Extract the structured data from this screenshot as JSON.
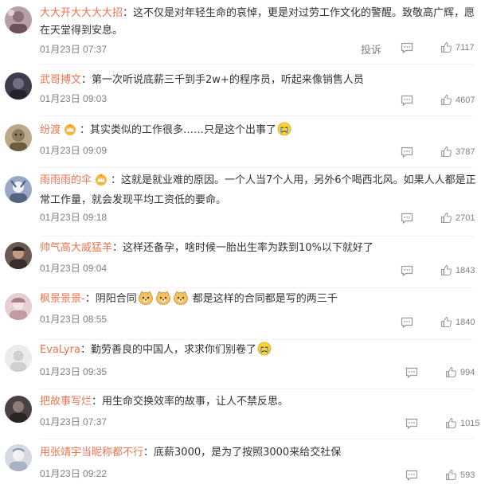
{
  "comments": [
    {
      "user": "大大开大大大大招",
      "sep": "：",
      "text": "这不仅是对年轻生命的哀悼，更是对过劳工作文化的警醒。致敬高广辉，愿在天堂得到安息。",
      "time": "01月23日 07:37",
      "report": "投诉",
      "likes": "7117",
      "avatar_color": "#c6b3b8"
    },
    {
      "user": "武哥搏文",
      "sep": "：",
      "text": "第一次听说底薪三千到手2w+的程序员，听起来像销售人员",
      "time": "01月23日 09:03",
      "likes": "4607",
      "avatar_color": "#4a4a5a"
    },
    {
      "user": "纷渡",
      "crown": true,
      "sep": "：",
      "text": "其实类似的工作很多……只是这个出事了",
      "emoji_after": [
        "cry"
      ],
      "time": "01月23日 09:09",
      "likes": "3787",
      "avatar_color": "#b7a486"
    },
    {
      "user": "雨雨雨的伞",
      "crown": true,
      "sep": "：",
      "text": "这就是就业难的原因。一个人当7个人用，另外6个喝西北风。如果人人都是正常工作量，就会发现平均工资低的要命。",
      "time": "01月23日 09:18",
      "likes": "2701",
      "avatar_color": "#8a9ab6"
    },
    {
      "user": "帅气高大威猛羊",
      "sep": "：",
      "text": "这样还备孕，啥时候一胎出生率为跌到10%以下就好了",
      "time": "01月23日 09:04",
      "likes": "1843",
      "avatar_color": "#5b4a44"
    },
    {
      "user": "枫景景景-",
      "sep": "：",
      "text_before": "阴阳合同",
      "emojis": [
        "doge",
        "doge",
        "doge"
      ],
      "text": "都是这样的合同都是写的两三千",
      "time": "01月23日 08:55",
      "likes": "1840",
      "avatar_color": "#d9bfc4"
    },
    {
      "user": "EvaLyra",
      "sep": "：",
      "text": "勤劳善良的中国人，求求你们别卷了",
      "emoji_after": [
        "cry"
      ],
      "time": "01月23日 09:35",
      "likes": "994",
      "avatar_color": "#e4e4e4"
    },
    {
      "user": "把故事写烂",
      "sep": "：",
      "text": "用生命交换效率的故事，让人不禁反思。",
      "time": "01月23日 07:37",
      "likes": "1015",
      "avatar_color": "#3f3a3a"
    },
    {
      "user": "用张靖宇当昵称都不行",
      "sep": "：",
      "text": "底薪3000，是为了按照3000来给交社保",
      "time": "01月23日 09:22",
      "likes": "593",
      "avatar_color": "#cfd3dd"
    }
  ],
  "colors": {
    "username": "#eb7350",
    "text": "#333333",
    "meta": "#808080"
  },
  "icons": {
    "reply": "comment-bubble-icon",
    "like": "thumbs-up-icon",
    "crown": "crown-badge-icon",
    "cry": "crying-face-emoji",
    "doge": "doge-emoji"
  }
}
